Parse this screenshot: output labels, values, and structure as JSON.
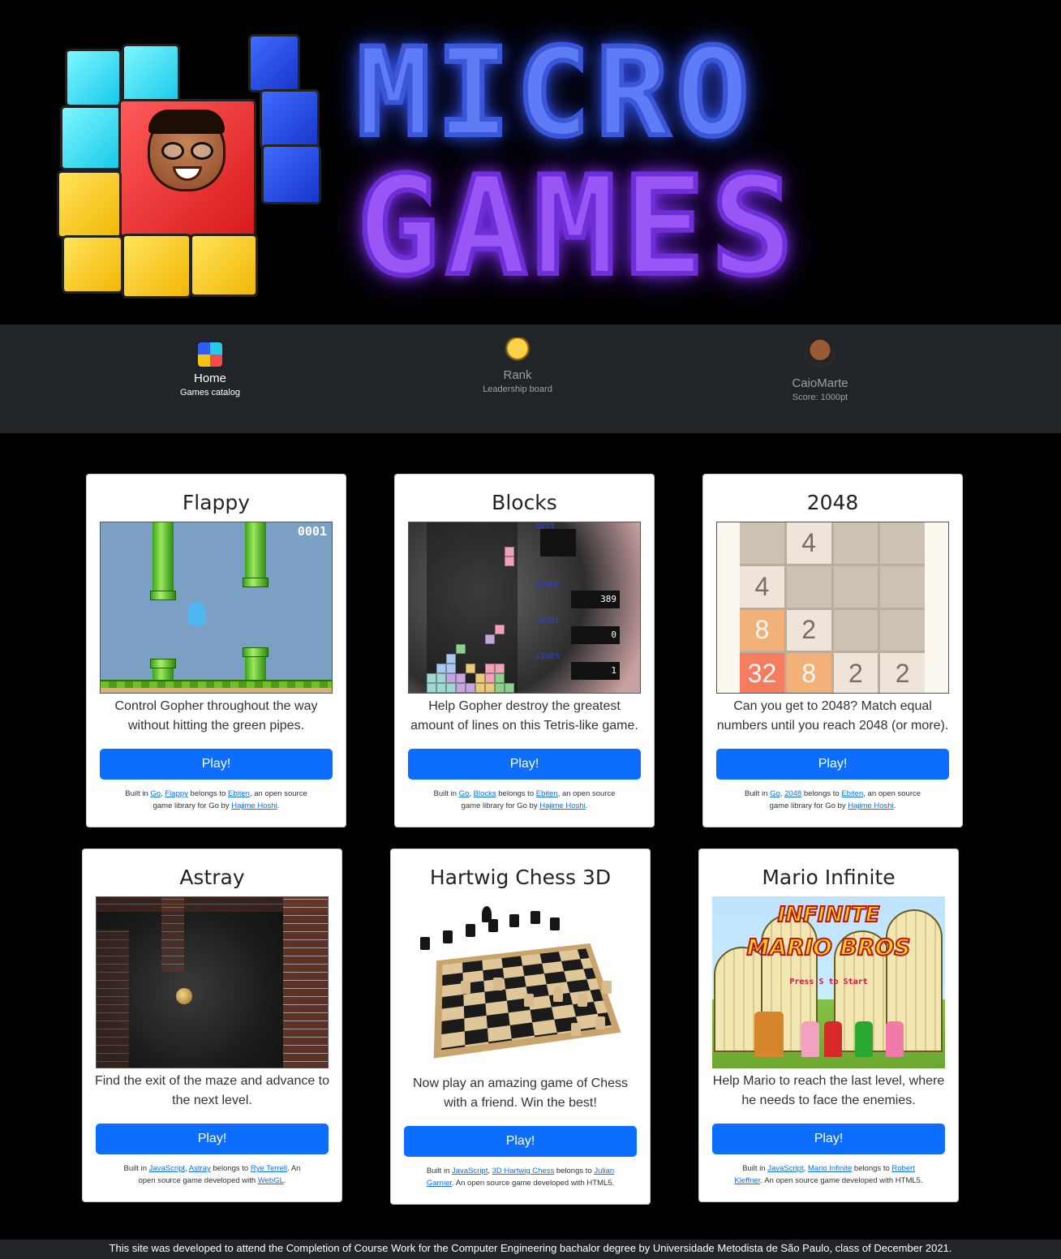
{
  "banner": {
    "title_line1": "MICRO",
    "title_line2": "GAMES"
  },
  "nav": {
    "items": [
      {
        "label": "Home",
        "sub": "Games catalog",
        "icon": "micro-games-logo-icon",
        "active": true
      },
      {
        "label": "Rank",
        "sub": "Leadership board",
        "icon": "trophy-icon",
        "active": false
      },
      {
        "label": "CaioMarte",
        "sub": "Score: 1000pt",
        "icon": "avatar-icon",
        "active": false
      }
    ]
  },
  "games": [
    {
      "title": "Flappy",
      "description": "Control Gopher throughout the way without hitting the green pipes.",
      "button": "Play!",
      "thumb_score": "0001",
      "foot": {
        "p1": "Built in ",
        "lang": "Go",
        "p2": ", ",
        "name": "Flappy",
        "p3": " belongs to ",
        "owner": "Ebiten",
        "p4": ", an open source game library for Go by ",
        "author": "Hajime Hoshi",
        "p5": "."
      }
    },
    {
      "title": "Blocks",
      "description": "Help Gopher destroy the greatest amount of lines on this Tetris-like game.",
      "button": "Play!",
      "panel": {
        "next": "NEXT",
        "score_label": "SCORE",
        "score": "389",
        "level_label": "LEVEL",
        "level": "0",
        "lines_label": "LINES",
        "lines": "1"
      },
      "foot": {
        "p1": "Built in ",
        "lang": "Go",
        "p2": ", ",
        "name": "Blocks",
        "p3": " belongs to ",
        "owner": "Ebiten",
        "p4": ", an open source game library for Go by ",
        "author": "Hajime Hoshi",
        "p5": "."
      }
    },
    {
      "title": "2048",
      "description": "Can you get to 2048? Match equal numbers until you reach 2048 (or more).",
      "button": "Play!",
      "tiles": [
        "",
        "4",
        "",
        "",
        "4",
        "",
        "",
        "",
        "8",
        "2",
        "",
        "",
        "32",
        "8",
        "2",
        "2"
      ],
      "foot": {
        "p1": "Built in ",
        "lang": "Go",
        "p2": ", ",
        "name": "2048",
        "p3": " belongs to ",
        "owner": "Ebiten",
        "p4": ", an open source game library for Go by ",
        "author": "Hajime Hoshi",
        "p5": "."
      }
    },
    {
      "title": "Astray",
      "description": "Find the exit of the maze and advance to the next level.",
      "button": "Play!",
      "foot": {
        "p1": "Built in ",
        "lang": "JavaScript",
        "p2": ", ",
        "name": "Astray",
        "p3": " belongs to ",
        "owner": "Rye Terrell",
        "p4": ". An open source game developed with ",
        "author": "WebGL",
        "p5": "."
      }
    },
    {
      "title": "Hartwig Chess 3D",
      "description": "Now play an amazing game of Chess with a friend. Win the best!",
      "button": "Play!",
      "foot": {
        "p1": "Built in ",
        "lang": "JavaScript",
        "p2": ", ",
        "name": "3D Hartwig Chess",
        "p3": " belongs to ",
        "owner": "Julian Garnier",
        "p4": ". An open source game developed with HTML5.",
        "author": "",
        "p5": ""
      }
    },
    {
      "title": "Mario Infinite",
      "description": "Help Mario to reach the last level, where he needs to face the enemies.",
      "button": "Play!",
      "thumb_title1": "INFINITE",
      "thumb_title2": "MARIO BROS",
      "thumb_press": "Press S to Start",
      "foot": {
        "p1": "Built in ",
        "lang": "JavaScript",
        "p2": ", ",
        "name": "Mario Infinite",
        "p3": " belongs to ",
        "owner": "Robert Kleffner",
        "p4": ". An open source game developed with HTML5.",
        "author": "",
        "p5": ""
      }
    }
  ],
  "footer": {
    "text": "This site was developed to attend the Completion of Course Work for the Computer Engineering bachalor degree by Universidade Metodista de São Paulo, class of December 2021."
  },
  "colors": {
    "primary": "#0d6efd",
    "nav_bg": "#212529",
    "page_bg": "#000000",
    "micro_blue": "#5e7cf5",
    "games_purple": "#9a55f5"
  }
}
